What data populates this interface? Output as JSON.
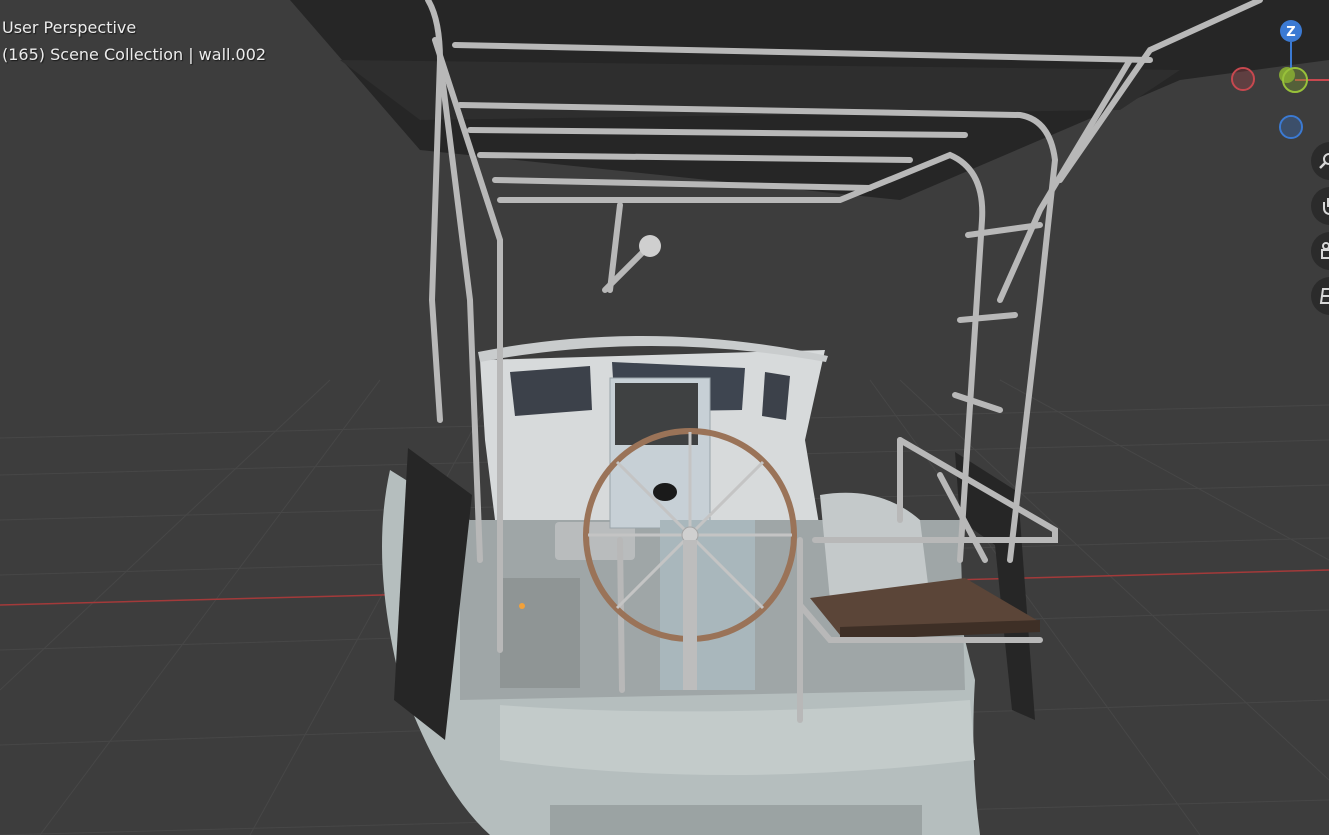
{
  "viewport": {
    "view_name": "User Perspective",
    "object_info": "(165) Scene Collection | wall.002",
    "background_color": "#3d3d3d",
    "x_axis_line_color": "#a33a3a"
  },
  "gizmo": {
    "z_label": "Z",
    "x_color": "#c7484f",
    "y_color": "#82a434",
    "z_color": "#3b7ad3"
  },
  "nav_buttons": [
    {
      "icon": "zoom-icon"
    },
    {
      "icon": "pan-hand-icon"
    },
    {
      "icon": "camera-icon"
    },
    {
      "icon": "orthographic-grid-icon"
    }
  ]
}
